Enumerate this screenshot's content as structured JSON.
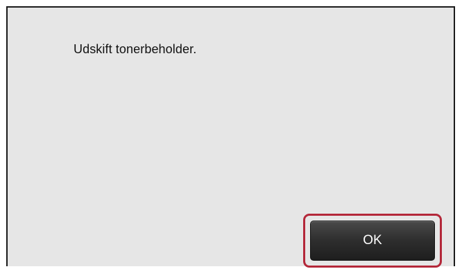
{
  "dialog": {
    "message": "Udskift tonerbeholder.",
    "ok_label": "OK"
  },
  "colors": {
    "dialog_background": "#e6e6e6",
    "dialog_border": "#1a1a1a",
    "button_background": "#2e2e2e",
    "button_text": "#ffffff",
    "focus_highlight": "#b4283a"
  }
}
